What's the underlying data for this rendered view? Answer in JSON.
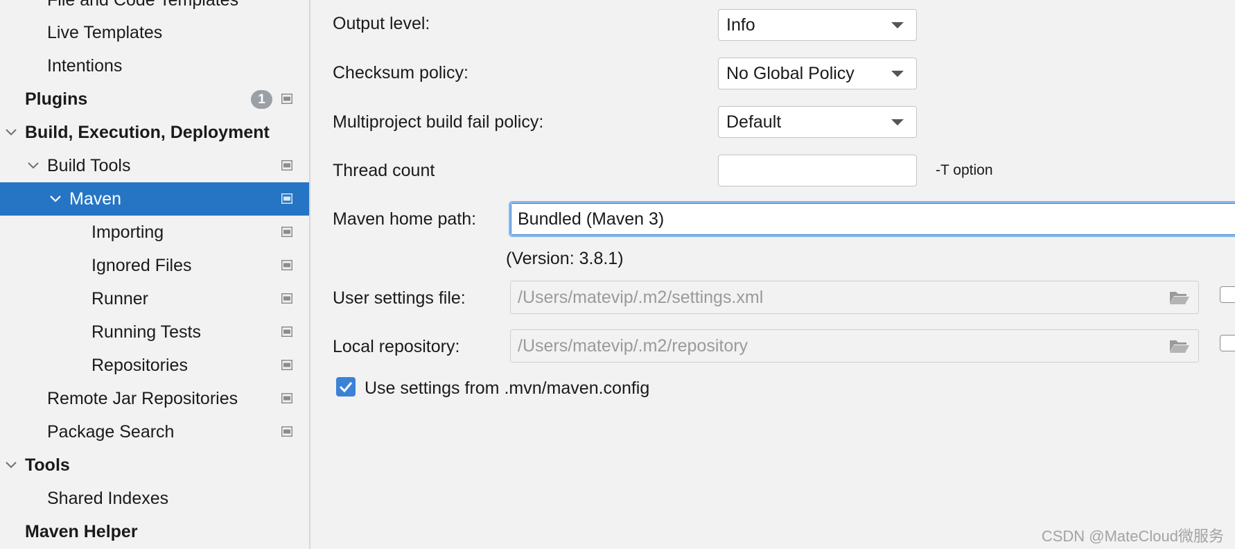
{
  "sidebar": {
    "items": [
      {
        "label": "File and Code Templates"
      },
      {
        "label": "Live Templates"
      },
      {
        "label": "Intentions"
      },
      {
        "label": "Plugins",
        "badge": "1"
      },
      {
        "label": "Build, Execution, Deployment"
      },
      {
        "label": "Build Tools"
      },
      {
        "label": "Maven"
      },
      {
        "label": "Importing"
      },
      {
        "label": "Ignored Files"
      },
      {
        "label": "Runner"
      },
      {
        "label": "Running Tests"
      },
      {
        "label": "Repositories"
      },
      {
        "label": "Remote Jar Repositories"
      },
      {
        "label": "Package Search"
      },
      {
        "label": "Tools"
      },
      {
        "label": "Shared Indexes"
      },
      {
        "label": "Maven Helper"
      }
    ],
    "selected_color": "#2675c4"
  },
  "form": {
    "output_level": {
      "label": "Output level:",
      "value": "Info"
    },
    "checksum_policy": {
      "label": "Checksum policy:",
      "value": "No Global Policy"
    },
    "fail_policy": {
      "label": "Multiproject build fail policy:",
      "value": "Default"
    },
    "thread_count": {
      "label": "Thread count",
      "value": "",
      "hint": "-T option"
    },
    "maven_home": {
      "label": "Maven home path:",
      "value": "Bundled (Maven 3)",
      "version": "(Version: 3.8.1)"
    },
    "user_settings": {
      "label": "User settings file:",
      "value": "/Users/matevip/.m2/settings.xml"
    },
    "local_repo": {
      "label": "Local repository:",
      "value": "/Users/matevip/.m2/repository"
    },
    "mvn_config": {
      "label": "Use settings from .mvn/maven.config",
      "checked": true
    }
  },
  "watermark": "CSDN @MateCloud微服务"
}
